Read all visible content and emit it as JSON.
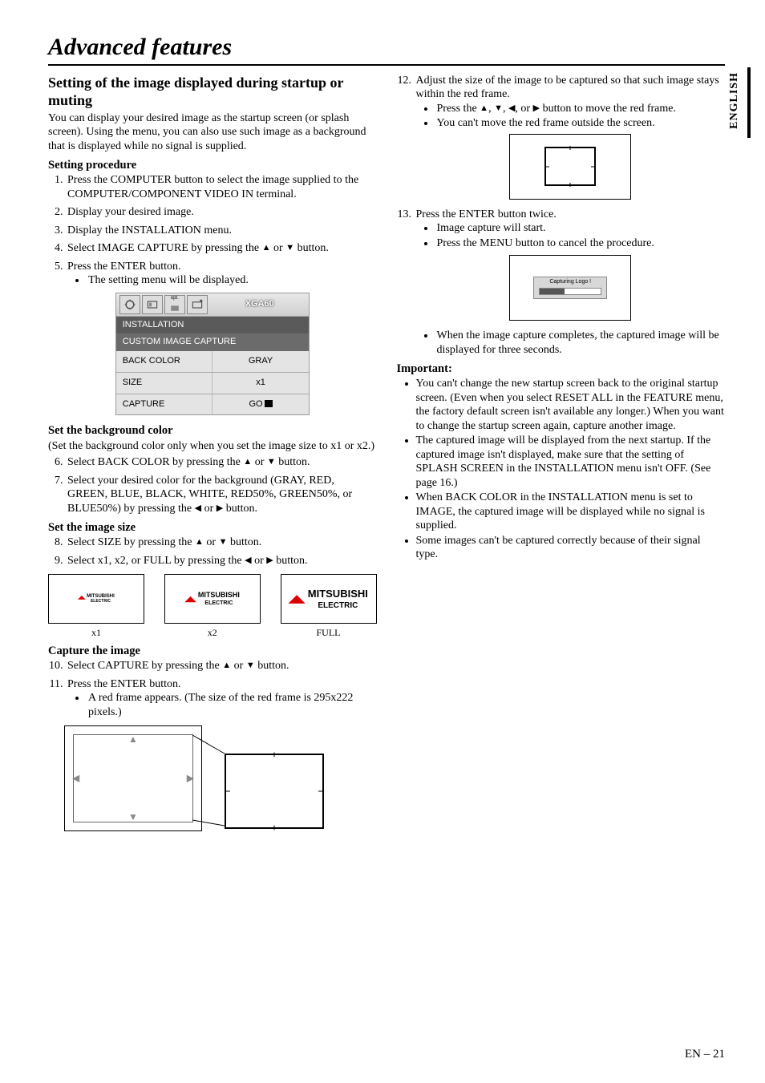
{
  "page": {
    "title": "Advanced features",
    "side_lang": "ENGLISH",
    "page_number": "EN – 21"
  },
  "left": {
    "h2": "Setting of the image displayed during startup or muting",
    "intro": "You can display your desired image as the startup screen (or splash screen). Using the menu, you can also use such image as a background that is displayed while no signal is supplied.",
    "setting_procedure_h": "Setting procedure",
    "steps_1": "Press the COMPUTER button to select the image supplied to the COMPUTER/COMPONENT VIDEO IN terminal.",
    "steps_2": "Display your desired image.",
    "steps_3": "Display the INSTALLATION menu.",
    "steps_4_a": "Select IMAGE CAPTURE by pressing the ",
    "steps_4_b": " or ",
    "steps_4_c": " button.",
    "steps_5": "Press the ENTER button.",
    "steps_5_bullet": "The setting menu will be displayed.",
    "menu": {
      "tab_opt": "opt.",
      "tab_right": "XGA60",
      "row_installation": "INSTALLATION",
      "row_custom": "CUSTOM IMAGE CAPTURE",
      "back_color_label": "BACK COLOR",
      "back_color_val": "GRAY",
      "size_label": "SIZE",
      "size_val": "x1",
      "capture_label": "CAPTURE",
      "capture_val": "GO"
    },
    "bg_h": "Set the background color",
    "bg_note": "(Set the background color only when you set the image size to x1 or x2.)",
    "steps_6_a": "Select BACK COLOR by pressing the ",
    "steps_6_b": " or ",
    "steps_6_c": " button.",
    "steps_7_a": "Select your desired color for the background (GRAY, RED, GREEN, BLUE, BLACK, WHITE, RED50%, GREEN50%, or  BLUE50%) by pressing the ",
    "steps_7_b": " or ",
    "steps_7_c": " button.",
    "size_h": "Set the image size",
    "steps_8_a": "Select SIZE by pressing the ",
    "steps_8_b": " or ",
    "steps_8_c": " button.",
    "steps_9_a": "Select x1, x2, or FULL by pressing the ",
    "steps_9_b": " or ",
    "steps_9_c": " button.",
    "size_fig": {
      "x1": "x1",
      "x2": "x2",
      "full": "FULL",
      "brand": "MITSUBISHI",
      "brand_sub": "ELECTRIC"
    },
    "capture_h": "Capture the image",
    "steps_10_a": "Select CAPTURE by pressing the ",
    "steps_10_b": " or ",
    "steps_10_c": " button.",
    "steps_11": "Press the ENTER button.",
    "steps_11_bullet": "A red frame appears.  (The size of the red frame is 295x222 pixels.)"
  },
  "right": {
    "steps_12": "Adjust the size of the image to be captured so that such image stays within the red frame.",
    "steps_12_b1_a": "Press the ",
    "steps_12_b1_b": ", ",
    "steps_12_b1_c": ", ",
    "steps_12_b1_d": ", or ",
    "steps_12_b1_e": " button to move the red frame.",
    "steps_12_b2": "You can't move the red frame outside the screen.",
    "steps_13": "Press the ENTER button twice.",
    "steps_13_b1": "Image capture will start.",
    "steps_13_b2": "Press the MENU button to cancel the procedure.",
    "capture_label": "Capturing Logo !",
    "steps_13_b3": "When the image capture completes, the captured image will be displayed for three seconds.",
    "important_h": "Important:",
    "imp_1": "You can't change the new startup screen back to the original startup screen.  (Even when you select RESET ALL in the FEATURE menu, the factory default screen isn't available any longer.) When you want to change the startup screen again, capture another image.",
    "imp_2": "The captured image will be displayed from the next startup.  If the captured image isn't displayed, make sure that the setting of SPLASH SCREEN in the INSTALLATION menu isn't OFF. (See page 16.)",
    "imp_3": "When BACK COLOR in the INSTALLATION menu is set to IMAGE, the captured image will be displayed while no signal is supplied.",
    "imp_4": "Some images can't be captured correctly because of their signal type."
  }
}
